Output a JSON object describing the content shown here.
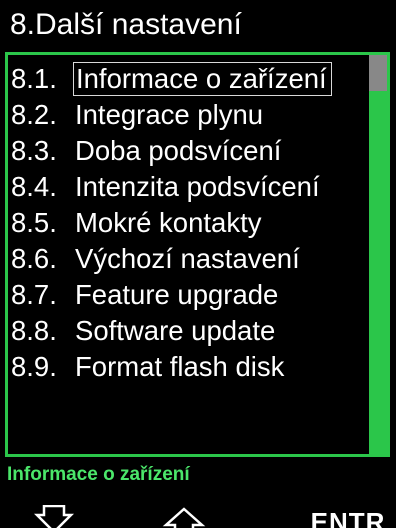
{
  "header": {
    "title": "8.Další nastavení"
  },
  "menu": {
    "items": [
      {
        "num": "8.1.",
        "label": "Informace o zařízení",
        "selected": true
      },
      {
        "num": "8.2.",
        "label": "Integrace plynu"
      },
      {
        "num": "8.3.",
        "label": "Doba podsvícení"
      },
      {
        "num": "8.4.",
        "label": "Intenzita podsvícení"
      },
      {
        "num": "8.5.",
        "label": "Mokré kontakty"
      },
      {
        "num": "8.6.",
        "label": "Výchozí nastavení"
      },
      {
        "num": "8.7.",
        "label": "Feature upgrade"
      },
      {
        "num": "8.8.",
        "label": "Software update"
      },
      {
        "num": "8.9.",
        "label": "Format flash disk"
      }
    ]
  },
  "status": {
    "text": "Informace o zařízení"
  },
  "softkeys": {
    "down_icon": "arrow-down-icon",
    "up_icon": "arrow-up-icon",
    "enter_label": "ENTR"
  },
  "colors": {
    "accent_green": "#2bc64a",
    "status_green": "#4be66a",
    "background": "#000000"
  }
}
